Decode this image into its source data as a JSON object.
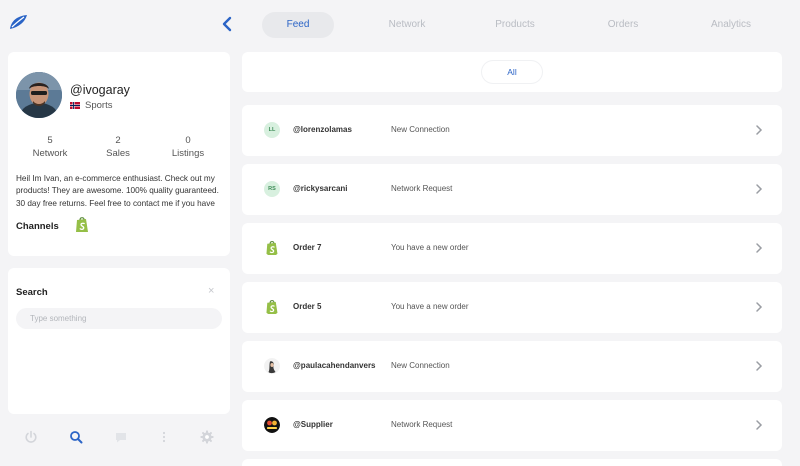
{
  "tabs": [
    "Feed",
    "Network",
    "Products",
    "Orders",
    "Analytics"
  ],
  "profile": {
    "username": "@ivogaray",
    "category": "Sports",
    "stats": [
      {
        "value": "5",
        "label": "Network"
      },
      {
        "value": "2",
        "label": "Sales"
      },
      {
        "value": "0",
        "label": "Listings"
      }
    ],
    "bio": "Heil Im Ivan, an e-commerce enthusiast. Check out my products! They are awesome. 100% quality guaranteed. 30 day free returns. Feel free to contact me if you have",
    "channels_label": "Channels"
  },
  "search": {
    "title": "Search",
    "close": "×",
    "placeholder": "Type something"
  },
  "feed": {
    "filter": "All",
    "items": [
      {
        "avatar": "LL",
        "name": "@lorenzolamas",
        "desc": "New Connection"
      },
      {
        "avatar": "RS",
        "name": "@rickysarcani",
        "desc": "Network Request"
      },
      {
        "name": "Order 7",
        "desc": "You have a new order"
      },
      {
        "name": "Order 5",
        "desc": "You have a new order"
      },
      {
        "name": "@paulacahendanvers",
        "desc": "New Connection"
      },
      {
        "name": "@Supplier",
        "desc": "Network Request"
      }
    ]
  },
  "colors": {
    "accent": "#2b64c6",
    "shopify": "#95bf47",
    "initials_bg": "#d8f0df"
  },
  "icons": {
    "logo": "leaf-logo-icon",
    "collapse": "chevron-left-icon",
    "row_chevron": "chevron-right-icon",
    "bottom_bar": [
      "power-icon",
      "search-icon",
      "chat-icon",
      "more-vertical-icon",
      "gear-icon"
    ]
  }
}
